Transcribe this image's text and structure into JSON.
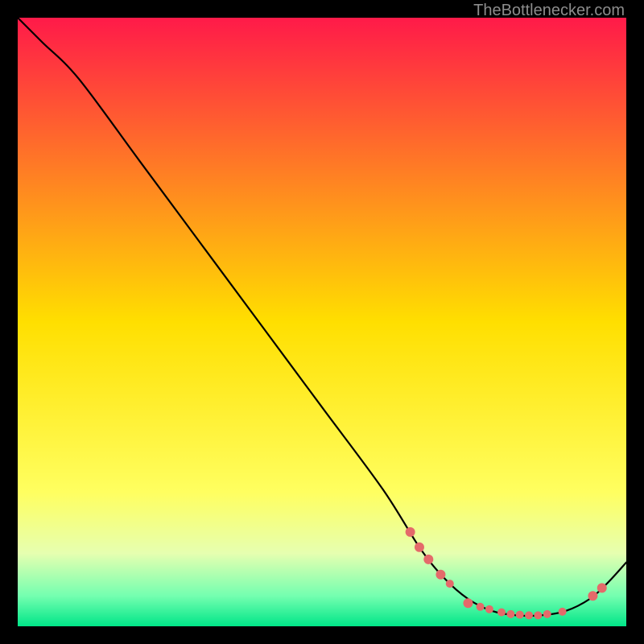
{
  "watermark": "TheBottlenecker.com",
  "chart_data": {
    "type": "line",
    "title": "",
    "xlabel": "",
    "ylabel": "",
    "xlim": [
      0,
      100
    ],
    "ylim": [
      0,
      100
    ],
    "grid": false,
    "background_gradient": {
      "stops": [
        {
          "offset": 0.0,
          "color": "#ff1a49"
        },
        {
          "offset": 0.5,
          "color": "#ffdf00"
        },
        {
          "offset": 0.78,
          "color": "#ffff60"
        },
        {
          "offset": 0.88,
          "color": "#e6ffb0"
        },
        {
          "offset": 0.95,
          "color": "#74ffb0"
        },
        {
          "offset": 1.0,
          "color": "#00e588"
        }
      ]
    },
    "series": [
      {
        "name": "curve",
        "x": [
          0,
          4,
          10,
          20,
          30,
          40,
          50,
          60,
          66,
          70,
          74,
          78,
          82,
          86,
          90,
          94,
          97,
          100
        ],
        "y": [
          100,
          96,
          90,
          76.5,
          63,
          49.5,
          36,
          22.5,
          13,
          8,
          4.5,
          2.5,
          1.8,
          1.8,
          2.5,
          4.5,
          7.2,
          10.5
        ]
      }
    ],
    "markers": {
      "name": "dots",
      "color": "#e46a6a",
      "radius_range": [
        4,
        7
      ],
      "points": [
        {
          "x": 64.5,
          "y": 15.5,
          "r": 6
        },
        {
          "x": 66.0,
          "y": 13.0,
          "r": 6
        },
        {
          "x": 67.5,
          "y": 11.0,
          "r": 6
        },
        {
          "x": 69.5,
          "y": 8.5,
          "r": 6
        },
        {
          "x": 71.0,
          "y": 7.0,
          "r": 5
        },
        {
          "x": 74.0,
          "y": 3.8,
          "r": 6
        },
        {
          "x": 76.0,
          "y": 3.2,
          "r": 5
        },
        {
          "x": 77.5,
          "y": 2.8,
          "r": 5
        },
        {
          "x": 79.5,
          "y": 2.3,
          "r": 5
        },
        {
          "x": 81.0,
          "y": 2.0,
          "r": 5
        },
        {
          "x": 82.5,
          "y": 1.9,
          "r": 5
        },
        {
          "x": 84.0,
          "y": 1.8,
          "r": 5
        },
        {
          "x": 85.5,
          "y": 1.8,
          "r": 5
        },
        {
          "x": 87.0,
          "y": 2.0,
          "r": 5
        },
        {
          "x": 89.5,
          "y": 2.4,
          "r": 5
        },
        {
          "x": 94.5,
          "y": 5.0,
          "r": 6
        },
        {
          "x": 96.0,
          "y": 6.3,
          "r": 6
        }
      ]
    }
  }
}
